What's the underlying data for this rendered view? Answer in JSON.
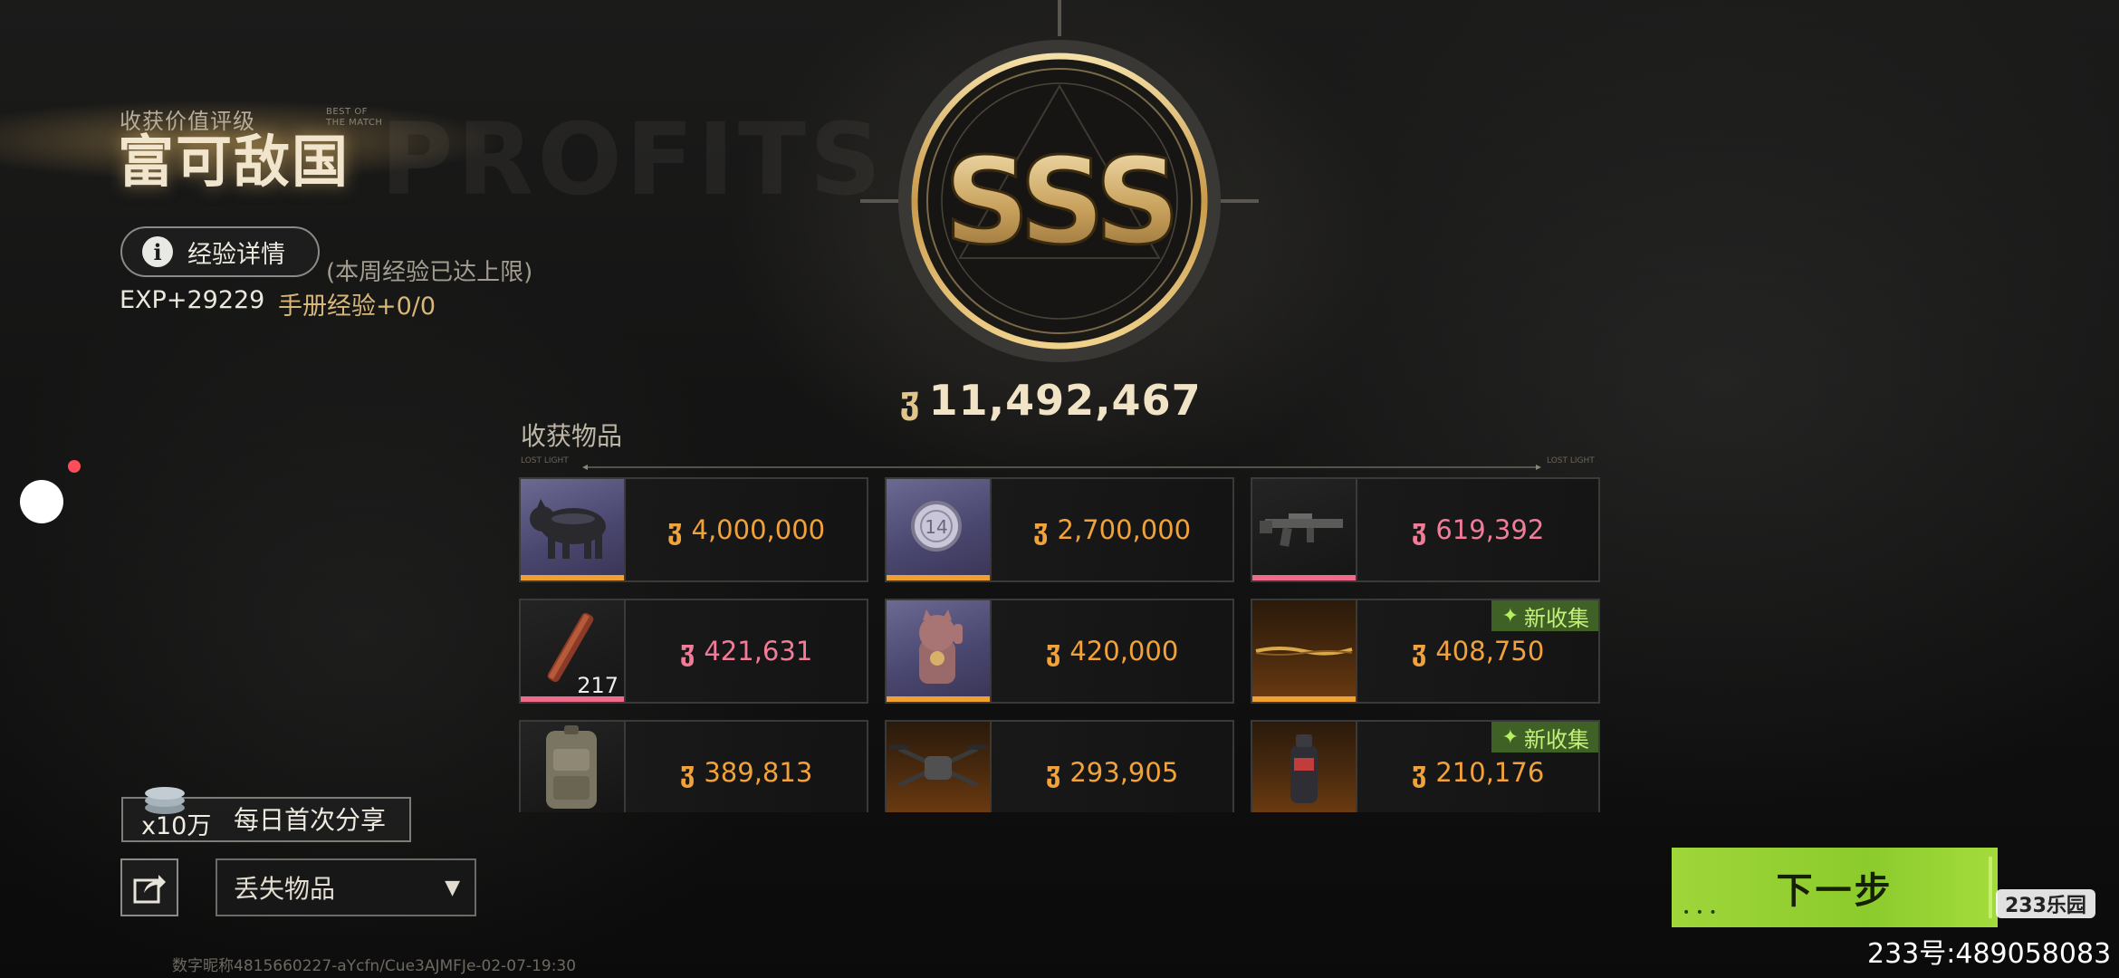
{
  "header": {
    "rating_label": "收获价值评级",
    "best_of_line1": "BEST OF",
    "best_of_line2": "THE MATCH",
    "rating_title": "富可敌国",
    "ghost_word": "PROFITS",
    "exp_details_label": "经验详情",
    "week_cap_note": "(本周经验已达上限)",
    "exp_gain": "EXP+29229",
    "manual_exp": "手册经验+0/0"
  },
  "badge": {
    "grade": "SSS",
    "total_value": "11,492,467",
    "currency_icon": "coin-icon"
  },
  "items_section": {
    "title": "收获物品",
    "line_left": "LOST LIGHT",
    "line_right": "LOST LIGHT",
    "items": [
      {
        "icon": "pig-figure-icon",
        "price": "4,000,000",
        "rarity_color": "#f0a030",
        "price_color": "#f2a23a",
        "new": false
      },
      {
        "icon": "coin-medal-icon",
        "price": "2,700,000",
        "rarity_color": "#f0a030",
        "price_color": "#f2a23a",
        "new": false
      },
      {
        "icon": "rifle-icon",
        "price": "619,392",
        "rarity_color": "#f06a8c",
        "price_color": "#f07c98",
        "new": false
      },
      {
        "icon": "ammo-pack-icon",
        "price": "421,631",
        "quantity": "217",
        "rarity_color": "#f06a8c",
        "price_color": "#f07c98",
        "new": false
      },
      {
        "icon": "lucky-cat-icon",
        "price": "420,000",
        "rarity_color": "#f0a030",
        "price_color": "#f2a23a",
        "new": false
      },
      {
        "icon": "gold-chain-icon",
        "price": "408,750",
        "rarity_color": "#f0a030",
        "price_color": "#f2a23a",
        "new": true
      },
      {
        "icon": "backpack-icon",
        "price": "389,813",
        "rarity_color": "#f0a030",
        "price_color": "#f2a23a",
        "new": false
      },
      {
        "icon": "drone-icon",
        "price": "293,905",
        "rarity_color": "#f0a030",
        "price_color": "#f2a23a",
        "new": false
      },
      {
        "icon": "canister-icon",
        "price": "210,176",
        "rarity_color": "#f0a030",
        "price_color": "#f2a23a",
        "new": true
      }
    ],
    "new_tag_label": "新收集"
  },
  "share": {
    "multiplier": "x10万",
    "label": "每日首次分享"
  },
  "lost_items_select": {
    "selected": "丢失物品"
  },
  "next_button": {
    "label": "下一步"
  },
  "footer": {
    "watermark_id": "数字昵称4815660227-aYcfn/Cue3AJMFJe-02-07-19:30"
  },
  "overlay": {
    "logo_233": "233乐园",
    "account_id": "233号:489058083"
  }
}
